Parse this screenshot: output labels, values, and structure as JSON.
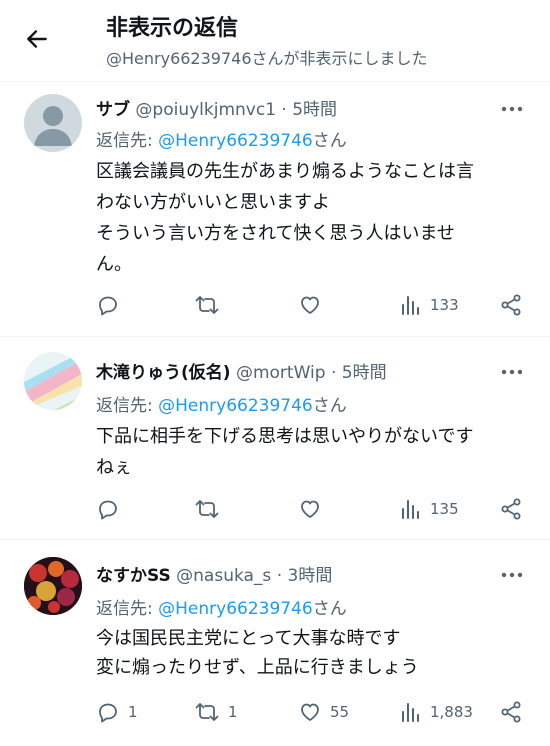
{
  "header": {
    "title": "非表示の返信",
    "subtitle": "@Henry66239746さんが非表示にしました"
  },
  "tweets": [
    {
      "name": "サブ",
      "handle": "@poiuylkjmnvc1",
      "dot": "·",
      "time": "5時間",
      "reply_prefix": "返信先: ",
      "reply_mention": "@Henry66239746",
      "reply_suffix": "さん",
      "lines": [
        "区議会議員の先生があまり煽るようなことは言",
        "わない方がいいと思いますよ",
        "そういう言い方をされて快く思う人はいませ",
        "ん。"
      ],
      "stats": {
        "replies": "",
        "retweets": "",
        "likes": "",
        "views": "133"
      }
    },
    {
      "name": "木滝りゅう(仮名)",
      "handle": "@mortWip",
      "dot": "·",
      "time": "5時間",
      "reply_prefix": "返信先: ",
      "reply_mention": "@Henry66239746",
      "reply_suffix": "さん",
      "lines": [
        "下品に相手を下げる思考は思いやりがないです",
        "ねぇ"
      ],
      "stats": {
        "replies": "",
        "retweets": "",
        "likes": "",
        "views": "135"
      }
    },
    {
      "name": "なすかSS",
      "handle": "@nasuka_s",
      "dot": "·",
      "time": "3時間",
      "reply_prefix": "返信先: ",
      "reply_mention": "@Henry66239746",
      "reply_suffix": "さん",
      "lines": [
        "今は国民民主党にとって大事な時です",
        "変に煽ったりせず、上品に行きましょう"
      ],
      "stats": {
        "replies": "1",
        "retweets": "1",
        "likes": "55",
        "views": "1,883"
      }
    }
  ],
  "icons": {
    "back": "arrow-left-icon",
    "more": "more-horizontal-icon",
    "reply": "reply-icon",
    "retweet": "retweet-icon",
    "like": "heart-icon",
    "views": "views-icon",
    "share": "share-icon"
  },
  "colors": {
    "accent": "#1d9bf0",
    "muted": "#536471",
    "text": "#0f1419"
  }
}
